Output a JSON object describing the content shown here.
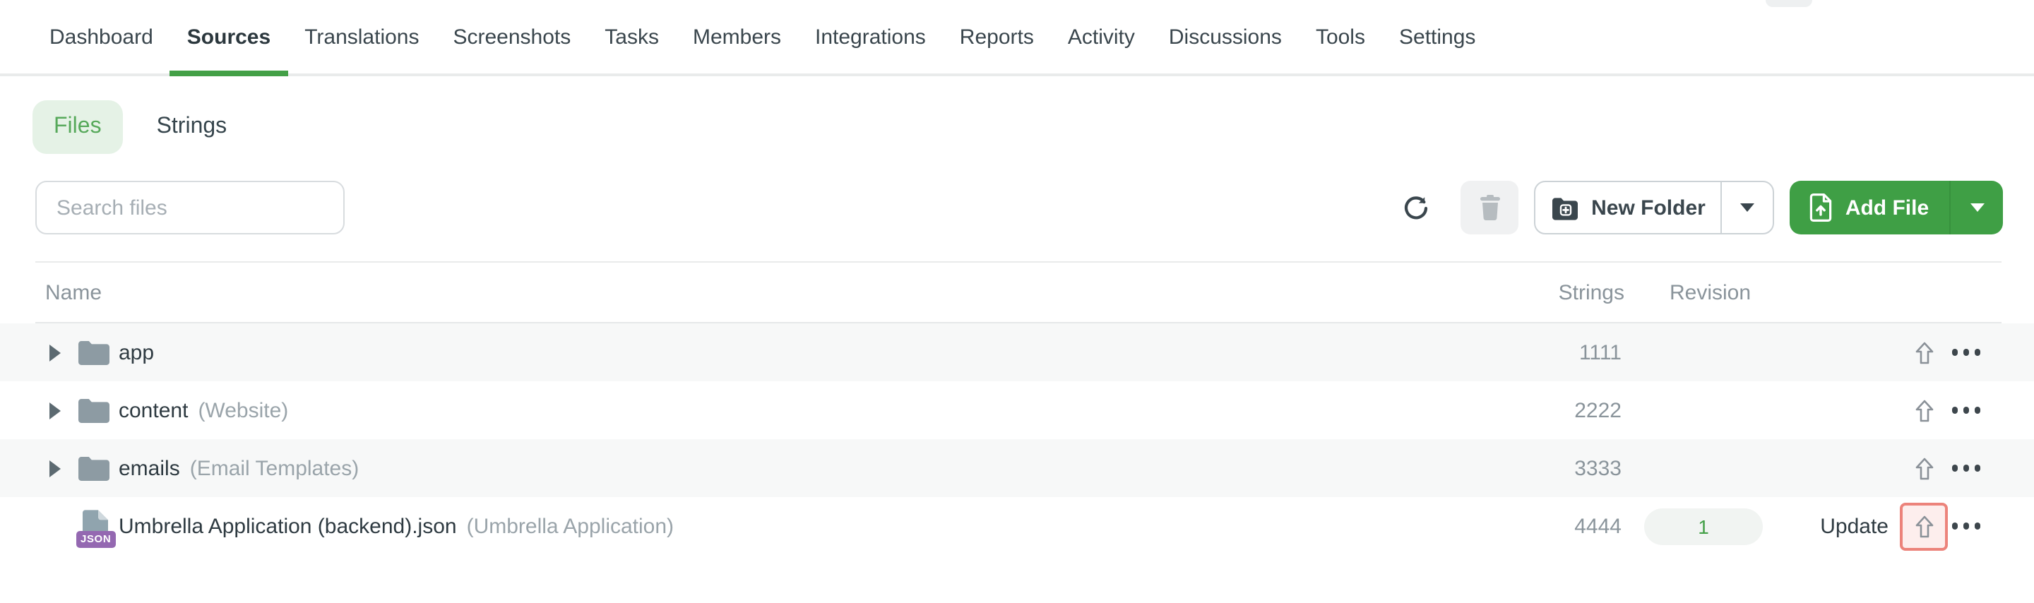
{
  "nav": {
    "items": [
      {
        "label": "Dashboard",
        "active": false
      },
      {
        "label": "Sources",
        "active": true
      },
      {
        "label": "Translations",
        "active": false
      },
      {
        "label": "Screenshots",
        "active": false
      },
      {
        "label": "Tasks",
        "active": false
      },
      {
        "label": "Members",
        "active": false
      },
      {
        "label": "Integrations",
        "active": false
      },
      {
        "label": "Reports",
        "active": false
      },
      {
        "label": "Activity",
        "active": false
      },
      {
        "label": "Discussions",
        "active": false
      },
      {
        "label": "Tools",
        "active": false
      },
      {
        "label": "Settings",
        "active": false
      }
    ]
  },
  "subtabs": {
    "files_label": "Files",
    "strings_label": "Strings",
    "active": "Files"
  },
  "toolbar": {
    "search_placeholder": "Search files",
    "new_folder_label": "New Folder",
    "add_file_label": "Add File"
  },
  "table": {
    "headers": {
      "name": "Name",
      "strings": "Strings",
      "revision": "Revision"
    },
    "rows": [
      {
        "type": "folder",
        "name": "app",
        "note": "",
        "strings": "1111",
        "revision": "",
        "update_label": ""
      },
      {
        "type": "folder",
        "name": "content",
        "note": "(Website)",
        "strings": "2222",
        "revision": "",
        "update_label": ""
      },
      {
        "type": "folder",
        "name": "emails",
        "note": "(Email Templates)",
        "strings": "3333",
        "revision": "",
        "update_label": ""
      },
      {
        "type": "json-file",
        "name": "Umbrella Application (backend).json",
        "note": "(Umbrella Application)",
        "strings": "4444",
        "revision": "1",
        "update_label": "Update",
        "file_badge": "JSON",
        "upload_highlighted": true
      }
    ]
  },
  "colors": {
    "accent_green": "#43a047",
    "add_file_button": "#3f9f45",
    "files_pill_bg": "#e5f2e6",
    "files_pill_text": "#57a95b",
    "revision_badge_text": "#43a047",
    "upload_highlight_border": "#ec837b",
    "upload_highlight_bg": "#fdeeed",
    "json_badge_bg": "#9468b1",
    "row_alt_bg": "#f7f8f8"
  }
}
